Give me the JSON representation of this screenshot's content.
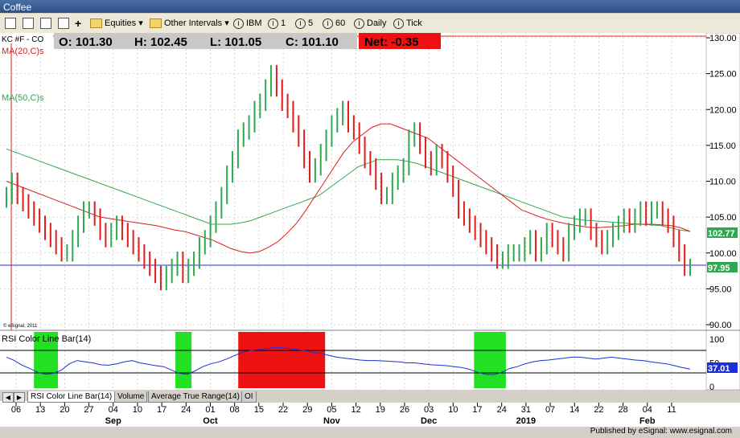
{
  "window": {
    "title": "Coffee"
  },
  "toolbar": {
    "equities": "Equities",
    "intervals": "Other Intervals",
    "sym_ibm": "IBM",
    "int_1": "1",
    "int_5": "5",
    "int_60": "60",
    "daily": "Daily",
    "tick": "Tick"
  },
  "header": {
    "symbol": "KC #F - CO",
    "open": "O: 101.30",
    "high": "H: 102.45",
    "low": "L: 101.05",
    "close": "C: 101.10",
    "net": "Net: -0.35",
    "ma20": "MA(20,C)s",
    "ma50": "MA(50,C)s",
    "copyright": "© eSignal, 2011"
  },
  "price_axis": {
    "ticks": [
      "130.00",
      "125.00",
      "120.00",
      "115.00",
      "110.00",
      "105.00",
      "100.00",
      "95.00",
      "90.00"
    ],
    "ma_last": "102.77",
    "price_last": "97.95"
  },
  "rsi": {
    "title": "RSI Color Line Bar(14)",
    "ticks": [
      "100",
      "50",
      "0"
    ],
    "last": "37.01"
  },
  "x_axis": {
    "days": [
      "06",
      "13",
      "20",
      "27",
      "04",
      "10",
      "17",
      "24",
      "01",
      "08",
      "15",
      "22",
      "29",
      "05",
      "12",
      "19",
      "26",
      "03",
      "10",
      "17",
      "24",
      "31",
      "07",
      "14",
      "22",
      "28",
      "04",
      "11"
    ],
    "months": [
      "Sep",
      "Oct",
      "Nov",
      "Dec",
      "2019",
      "Feb"
    ]
  },
  "tabs": [
    "RSI Color Line Bar(14)",
    "Volume",
    "Average True Range(14)",
    "OI"
  ],
  "footer": {
    "credit": "Published by eSignal: www.esignal.com"
  },
  "colors": {
    "up": "#2fa84f",
    "down": "#e01c1c",
    "ma20": "#e01c1c",
    "ma50": "#2fa84f",
    "hline": "#1c2fd6",
    "rsi_line": "#1c2fd6",
    "rsi_green": "#22e022",
    "rsi_red": "#ee1111"
  },
  "chart_data": [
    {
      "type": "candlestick",
      "title": "Coffee",
      "ylim": [
        90,
        130
      ],
      "series": [
        {
          "name": "close",
          "values": [
            108,
            110,
            108,
            107,
            106,
            105,
            104,
            103,
            102,
            101,
            100,
            100,
            102,
            104,
            106,
            106,
            105,
            103,
            102,
            103,
            104,
            103,
            102,
            101,
            100,
            99,
            98,
            97,
            96,
            97,
            98,
            99,
            97,
            98,
            99,
            101,
            102,
            104,
            106,
            108,
            111,
            113,
            116,
            117,
            118,
            120,
            121,
            123,
            125,
            123,
            121,
            120,
            118,
            116,
            113,
            111,
            112,
            114,
            116,
            118,
            119,
            120,
            118,
            117,
            115,
            113,
            112,
            110,
            108,
            108,
            110,
            111,
            112,
            116,
            117,
            115,
            113,
            112,
            114,
            113,
            111,
            109,
            106,
            105,
            104,
            103,
            102,
            101,
            100,
            99,
            99,
            100,
            100,
            100,
            101,
            102,
            100,
            101,
            103,
            102,
            101,
            100,
            103,
            104,
            105,
            105,
            103,
            102,
            101,
            102,
            103,
            104,
            105,
            104,
            105,
            106,
            105,
            106,
            106,
            105,
            104,
            102,
            100,
            98,
            98
          ]
        },
        {
          "name": "MA(20,C)s",
          "values": [
            110,
            109.5,
            109,
            108.5,
            108,
            107.5,
            107,
            106.5,
            106,
            105.5,
            105,
            104.8,
            104.6,
            104.4,
            104.2,
            104,
            103.8,
            103.5,
            103.2,
            103,
            102.6,
            102.2,
            101.8,
            101.2,
            100.6,
            100.2,
            100,
            100.2,
            100.8,
            101.6,
            102.8,
            104.2,
            106,
            108,
            110,
            112,
            114,
            115.5,
            116.5,
            117.5,
            118,
            118,
            117.5,
            117,
            116.5,
            116,
            115,
            114,
            113,
            112,
            111,
            110,
            109,
            108,
            107,
            106,
            105.5,
            105,
            104.6,
            104.3,
            104,
            103.8,
            103.6,
            103.5,
            103.6,
            103.7,
            103.8,
            104,
            104,
            104,
            103.9,
            103.8,
            103.5,
            103
          ]
        },
        {
          "name": "MA(50,C)s",
          "values": [
            114.5,
            114,
            113.5,
            113,
            112.5,
            112,
            111.5,
            111,
            110.5,
            110,
            109.5,
            109,
            108.5,
            108,
            107.5,
            107,
            106.5,
            106,
            105.5,
            105,
            104.5,
            104,
            104,
            104,
            104.2,
            104.5,
            105,
            105.5,
            106,
            106.5,
            107,
            107.5,
            108,
            109,
            110,
            111,
            112,
            112.5,
            113,
            113,
            113,
            112.8,
            112.5,
            112,
            111.5,
            111,
            110.5,
            110,
            109.5,
            109,
            108.5,
            108,
            107.5,
            107,
            106.5,
            106,
            105.5,
            105,
            104.8,
            104.6,
            104.5,
            104.4,
            104.3,
            104.2,
            104.1,
            104,
            103.9,
            103.8,
            103.5,
            103.2,
            103
          ]
        }
      ]
    },
    {
      "type": "line",
      "title": "RSI Color Line Bar(14)",
      "ylim": [
        0,
        100
      ],
      "series": [
        {
          "name": "RSI",
          "values": [
            62,
            55,
            45,
            38,
            30,
            26,
            28,
            35,
            48,
            55,
            52,
            50,
            46,
            45,
            48,
            52,
            55,
            50,
            47,
            44,
            42,
            35,
            28,
            26,
            33,
            42,
            48,
            52,
            58,
            65,
            72,
            76,
            78,
            80,
            82,
            82,
            80,
            78,
            76,
            72,
            70,
            66,
            62,
            60,
            58,
            56,
            55,
            55,
            54,
            53,
            52,
            50,
            50,
            48,
            46,
            45,
            44,
            42,
            40,
            36,
            30,
            26,
            25,
            30,
            38,
            42,
            48,
            52,
            55,
            56,
            58,
            60,
            62,
            62,
            60,
            58,
            60,
            62,
            60,
            58,
            56,
            55,
            52,
            50,
            48,
            44,
            40,
            37
          ]
        }
      ]
    }
  ]
}
